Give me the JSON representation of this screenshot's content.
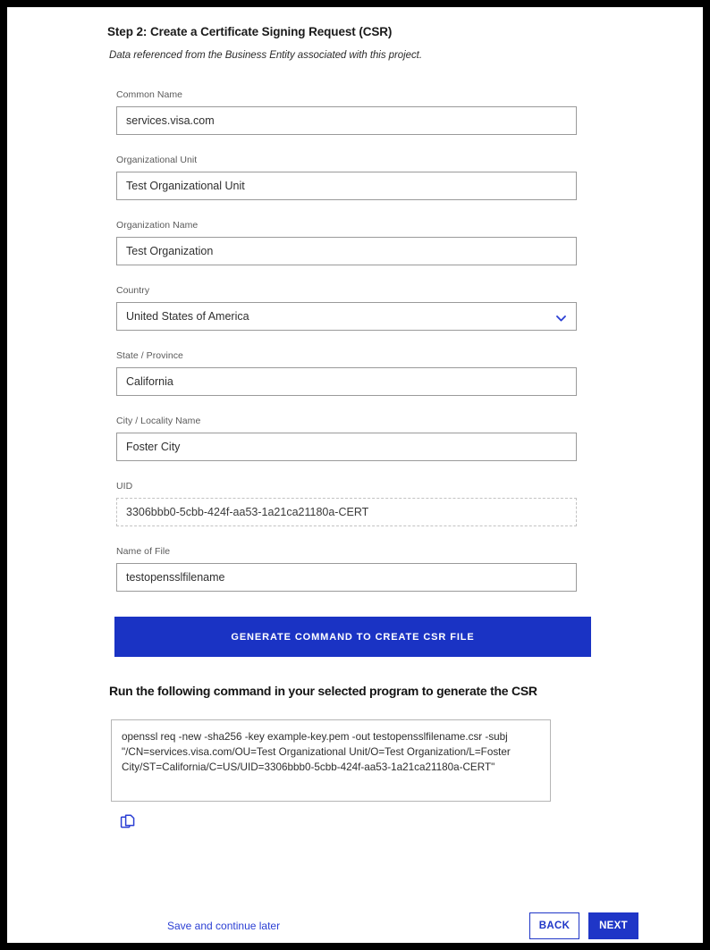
{
  "step": {
    "title": "Step 2: Create a Certificate Signing Request (CSR)",
    "subtitle": "Data referenced from the Business Entity associated with this project."
  },
  "form": {
    "fields": [
      {
        "label": "Common Name",
        "value": "services.visa.com",
        "type": "text"
      },
      {
        "label": "Organizational Unit",
        "value": "Test Organizational Unit",
        "type": "text"
      },
      {
        "label": "Organization Name",
        "value": "Test Organization",
        "type": "text"
      },
      {
        "label": "Country",
        "value": "United States of America",
        "type": "select"
      },
      {
        "label": "State / Province",
        "value": "California",
        "type": "text"
      },
      {
        "label": "City / Locality Name",
        "value": "Foster City",
        "type": "text"
      },
      {
        "label": "UID",
        "value": "3306bbb0-5cbb-424f-aa53-1a21ca21180a-CERT",
        "type": "readonly"
      },
      {
        "label": "Name of File",
        "value": "testopensslfilename",
        "type": "text"
      }
    ]
  },
  "generate_button": {
    "label": "GENERATE COMMAND TO CREATE CSR FILE"
  },
  "command_section": {
    "heading": "Run the following command in your selected program to generate the CSR",
    "command": "openssl req -new -sha256 -key example-key.pem -out testopensslfilename.csr -subj \"/CN=services.visa.com/OU=Test Organizational Unit/O=Test Organization/L=Foster City/ST=California/C=US/UID=3306bbb0-5cbb-424f-aa53-1a21ca21180a-CERT\"",
    "copy_icon": "copy-icon"
  },
  "footer": {
    "save_link": "Save and continue later",
    "back_label": "BACK",
    "next_label": "NEXT"
  },
  "colors": {
    "primary_blue": "#1f36c7",
    "generate_blue": "#1a33c4",
    "link_blue": "#2b3fd4",
    "label_gray": "#5a5a5a",
    "border_gray": "#9a9a9a"
  },
  "icons": {
    "chevron_down": "chevron-down-icon"
  }
}
